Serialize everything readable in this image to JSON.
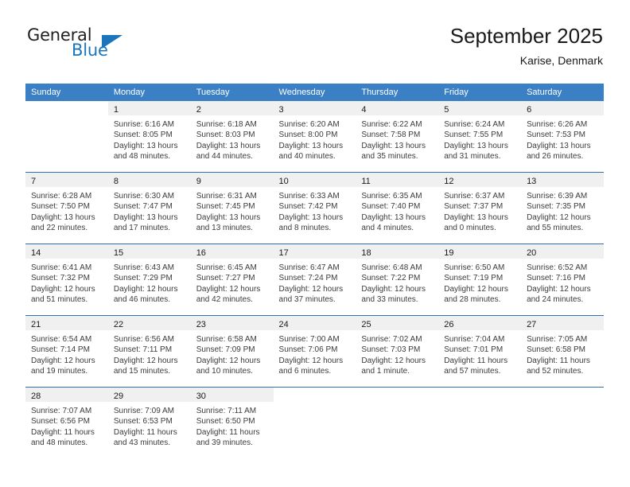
{
  "logo": {
    "word_top": "General",
    "word_bottom": "Blue",
    "triangle_color": "#1b75bc"
  },
  "header": {
    "title": "September 2025",
    "subtitle": "Karise, Denmark"
  },
  "theme": {
    "header_blue": "#3b7fc4",
    "row_divider_blue": "#2f6fb5",
    "daynum_band": "#f0f0f0",
    "text": "#3b3b3b"
  },
  "calendar": {
    "weekday_headers": [
      "Sunday",
      "Monday",
      "Tuesday",
      "Wednesday",
      "Thursday",
      "Friday",
      "Saturday"
    ],
    "weeks": [
      [
        {
          "day": "",
          "lines": []
        },
        {
          "day": "1",
          "lines": [
            "Sunrise: 6:16 AM",
            "Sunset: 8:05 PM",
            "Daylight: 13 hours",
            "and 48 minutes."
          ]
        },
        {
          "day": "2",
          "lines": [
            "Sunrise: 6:18 AM",
            "Sunset: 8:03 PM",
            "Daylight: 13 hours",
            "and 44 minutes."
          ]
        },
        {
          "day": "3",
          "lines": [
            "Sunrise: 6:20 AM",
            "Sunset: 8:00 PM",
            "Daylight: 13 hours",
            "and 40 minutes."
          ]
        },
        {
          "day": "4",
          "lines": [
            "Sunrise: 6:22 AM",
            "Sunset: 7:58 PM",
            "Daylight: 13 hours",
            "and 35 minutes."
          ]
        },
        {
          "day": "5",
          "lines": [
            "Sunrise: 6:24 AM",
            "Sunset: 7:55 PM",
            "Daylight: 13 hours",
            "and 31 minutes."
          ]
        },
        {
          "day": "6",
          "lines": [
            "Sunrise: 6:26 AM",
            "Sunset: 7:53 PM",
            "Daylight: 13 hours",
            "and 26 minutes."
          ]
        }
      ],
      [
        {
          "day": "7",
          "lines": [
            "Sunrise: 6:28 AM",
            "Sunset: 7:50 PM",
            "Daylight: 13 hours",
            "and 22 minutes."
          ]
        },
        {
          "day": "8",
          "lines": [
            "Sunrise: 6:30 AM",
            "Sunset: 7:47 PM",
            "Daylight: 13 hours",
            "and 17 minutes."
          ]
        },
        {
          "day": "9",
          "lines": [
            "Sunrise: 6:31 AM",
            "Sunset: 7:45 PM",
            "Daylight: 13 hours",
            "and 13 minutes."
          ]
        },
        {
          "day": "10",
          "lines": [
            "Sunrise: 6:33 AM",
            "Sunset: 7:42 PM",
            "Daylight: 13 hours",
            "and 8 minutes."
          ]
        },
        {
          "day": "11",
          "lines": [
            "Sunrise: 6:35 AM",
            "Sunset: 7:40 PM",
            "Daylight: 13 hours",
            "and 4 minutes."
          ]
        },
        {
          "day": "12",
          "lines": [
            "Sunrise: 6:37 AM",
            "Sunset: 7:37 PM",
            "Daylight: 13 hours",
            "and 0 minutes."
          ]
        },
        {
          "day": "13",
          "lines": [
            "Sunrise: 6:39 AM",
            "Sunset: 7:35 PM",
            "Daylight: 12 hours",
            "and 55 minutes."
          ]
        }
      ],
      [
        {
          "day": "14",
          "lines": [
            "Sunrise: 6:41 AM",
            "Sunset: 7:32 PM",
            "Daylight: 12 hours",
            "and 51 minutes."
          ]
        },
        {
          "day": "15",
          "lines": [
            "Sunrise: 6:43 AM",
            "Sunset: 7:29 PM",
            "Daylight: 12 hours",
            "and 46 minutes."
          ]
        },
        {
          "day": "16",
          "lines": [
            "Sunrise: 6:45 AM",
            "Sunset: 7:27 PM",
            "Daylight: 12 hours",
            "and 42 minutes."
          ]
        },
        {
          "day": "17",
          "lines": [
            "Sunrise: 6:47 AM",
            "Sunset: 7:24 PM",
            "Daylight: 12 hours",
            "and 37 minutes."
          ]
        },
        {
          "day": "18",
          "lines": [
            "Sunrise: 6:48 AM",
            "Sunset: 7:22 PM",
            "Daylight: 12 hours",
            "and 33 minutes."
          ]
        },
        {
          "day": "19",
          "lines": [
            "Sunrise: 6:50 AM",
            "Sunset: 7:19 PM",
            "Daylight: 12 hours",
            "and 28 minutes."
          ]
        },
        {
          "day": "20",
          "lines": [
            "Sunrise: 6:52 AM",
            "Sunset: 7:16 PM",
            "Daylight: 12 hours",
            "and 24 minutes."
          ]
        }
      ],
      [
        {
          "day": "21",
          "lines": [
            "Sunrise: 6:54 AM",
            "Sunset: 7:14 PM",
            "Daylight: 12 hours",
            "and 19 minutes."
          ]
        },
        {
          "day": "22",
          "lines": [
            "Sunrise: 6:56 AM",
            "Sunset: 7:11 PM",
            "Daylight: 12 hours",
            "and 15 minutes."
          ]
        },
        {
          "day": "23",
          "lines": [
            "Sunrise: 6:58 AM",
            "Sunset: 7:09 PM",
            "Daylight: 12 hours",
            "and 10 minutes."
          ]
        },
        {
          "day": "24",
          "lines": [
            "Sunrise: 7:00 AM",
            "Sunset: 7:06 PM",
            "Daylight: 12 hours",
            "and 6 minutes."
          ]
        },
        {
          "day": "25",
          "lines": [
            "Sunrise: 7:02 AM",
            "Sunset: 7:03 PM",
            "Daylight: 12 hours",
            "and 1 minute."
          ]
        },
        {
          "day": "26",
          "lines": [
            "Sunrise: 7:04 AM",
            "Sunset: 7:01 PM",
            "Daylight: 11 hours",
            "and 57 minutes."
          ]
        },
        {
          "day": "27",
          "lines": [
            "Sunrise: 7:05 AM",
            "Sunset: 6:58 PM",
            "Daylight: 11 hours",
            "and 52 minutes."
          ]
        }
      ],
      [
        {
          "day": "28",
          "lines": [
            "Sunrise: 7:07 AM",
            "Sunset: 6:56 PM",
            "Daylight: 11 hours",
            "and 48 minutes."
          ]
        },
        {
          "day": "29",
          "lines": [
            "Sunrise: 7:09 AM",
            "Sunset: 6:53 PM",
            "Daylight: 11 hours",
            "and 43 minutes."
          ]
        },
        {
          "day": "30",
          "lines": [
            "Sunrise: 7:11 AM",
            "Sunset: 6:50 PM",
            "Daylight: 11 hours",
            "and 39 minutes."
          ]
        },
        {
          "day": "",
          "lines": []
        },
        {
          "day": "",
          "lines": []
        },
        {
          "day": "",
          "lines": []
        },
        {
          "day": "",
          "lines": []
        }
      ]
    ]
  }
}
